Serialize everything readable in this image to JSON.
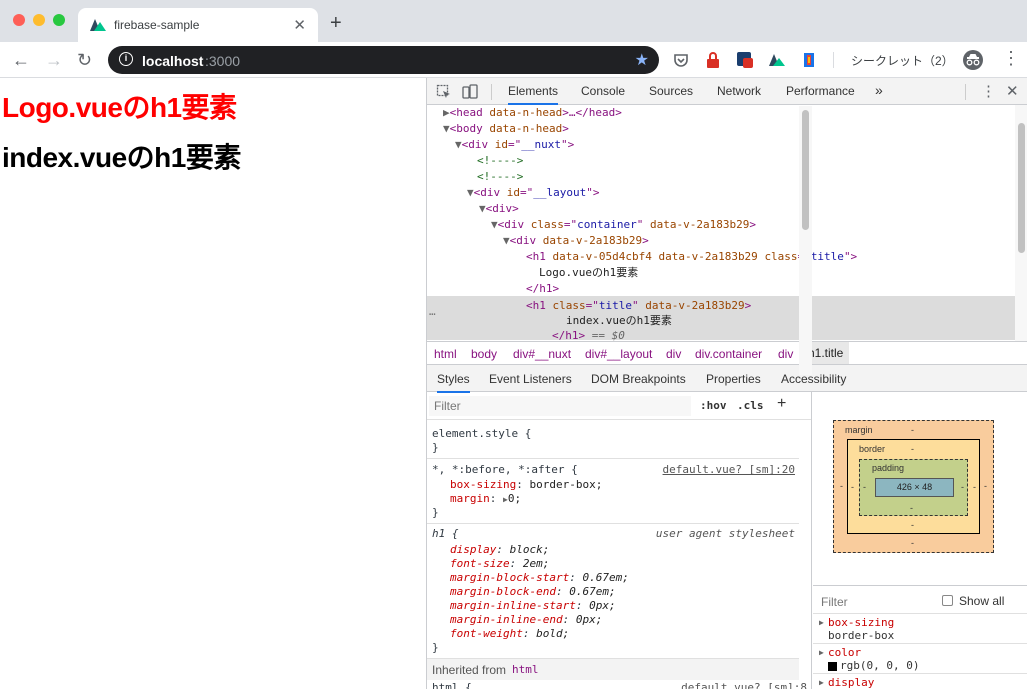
{
  "browser": {
    "tab_title": "firebase-sample",
    "tab_close": "✕",
    "new_tab": "+",
    "url_host": "localhost",
    "url_port": ":3000",
    "incognito_label": "シークレット（2）"
  },
  "page": {
    "heading_logo": "Logo.vueのh1要素",
    "heading_index": "index.vueのh1要素",
    "heading_logo_color": "#ff0000",
    "heading_index_color": "#000000"
  },
  "devtools": {
    "tabs": [
      "Elements",
      "Console",
      "Sources",
      "Network",
      "Performance",
      "»"
    ],
    "dom": {
      "l1": [
        "<head ",
        "data-n-head",
        ">…</head>"
      ],
      "l2": [
        "<body ",
        "data-n-head",
        ">"
      ],
      "l3": [
        "<div ",
        "id",
        "=\"",
        "__nuxt",
        "\">"
      ],
      "l4": "<!---->",
      "l5": "<!---->",
      "l6": [
        "<div ",
        "id",
        "=\"",
        "__layout",
        "\">"
      ],
      "l7": "<div>",
      "l8": [
        "<div ",
        "class",
        "=\"",
        "container",
        "\" ",
        "data-v-2a183b29",
        ">"
      ],
      "l9": [
        "<div ",
        "data-v-2a183b29",
        ">"
      ],
      "l10": [
        "<h1 ",
        "data-v-05d4cbf4",
        " ",
        "data-v-2a183b29",
        " ",
        "class",
        "=\"",
        "title",
        "\">"
      ],
      "l11": "Logo.vueのh1要素",
      "l12": "</h1>",
      "l13": [
        "<h1 ",
        "class",
        "=\"",
        "title",
        "\" ",
        "data-v-2a183b29",
        ">"
      ],
      "l14": "index.vueのh1要素",
      "l15": "</h1>",
      "l15b": " == $0",
      "dots": "…"
    },
    "breadcrumbs": [
      "html",
      "body",
      "div#__nuxt",
      "div#__layout",
      "div",
      "div.container",
      "div",
      "h1.title"
    ],
    "subtabs": [
      "Styles",
      "Event Listeners",
      "DOM Breakpoints",
      "Properties",
      "Accessibility"
    ],
    "styles": {
      "filter_placeholder": "Filter",
      "hov": ":hov",
      "cls": ".cls",
      "plus": "+",
      "element_style": "element.style {",
      "close_brace": "}",
      "rule1_selector": "*, *:before, *:after {",
      "rule1_source": "default.vue? [sm]:20",
      "rule1_props": [
        {
          "name": "box-sizing",
          "value": "border-box;"
        },
        {
          "name": "margin",
          "value": "0;"
        }
      ],
      "rule1_margin_arrow": "▶",
      "rule2_selector": "h1 {",
      "rule2_source": "user agent stylesheet",
      "rule2_props": [
        {
          "name": "display",
          "value": "block;"
        },
        {
          "name": "font-size",
          "value": "2em;"
        },
        {
          "name": "margin-block-start",
          "value": "0.67em;"
        },
        {
          "name": "margin-block-end",
          "value": "0.67em;"
        },
        {
          "name": "margin-inline-start",
          "value": "0px;"
        },
        {
          "name": "margin-inline-end",
          "value": "0px;"
        },
        {
          "name": "font-weight",
          "value": "bold;"
        }
      ],
      "inherited_label": "Inherited from ",
      "inherited_from": "html",
      "rule3_selector": "html {",
      "rule3_source": "default.vue? [sm]:8"
    },
    "boxmodel": {
      "margin_label": "margin",
      "border_label": "border",
      "padding_label": "padding",
      "dash": "-",
      "content_size": "426 × 48"
    },
    "computed": {
      "filter_placeholder": "Filter",
      "show_all": "Show all",
      "props": [
        {
          "name": "box-sizing",
          "value": "border-box"
        },
        {
          "name": "color",
          "value": "rgb(0, 0, 0)"
        },
        {
          "name": "display",
          "value": ""
        }
      ]
    }
  }
}
